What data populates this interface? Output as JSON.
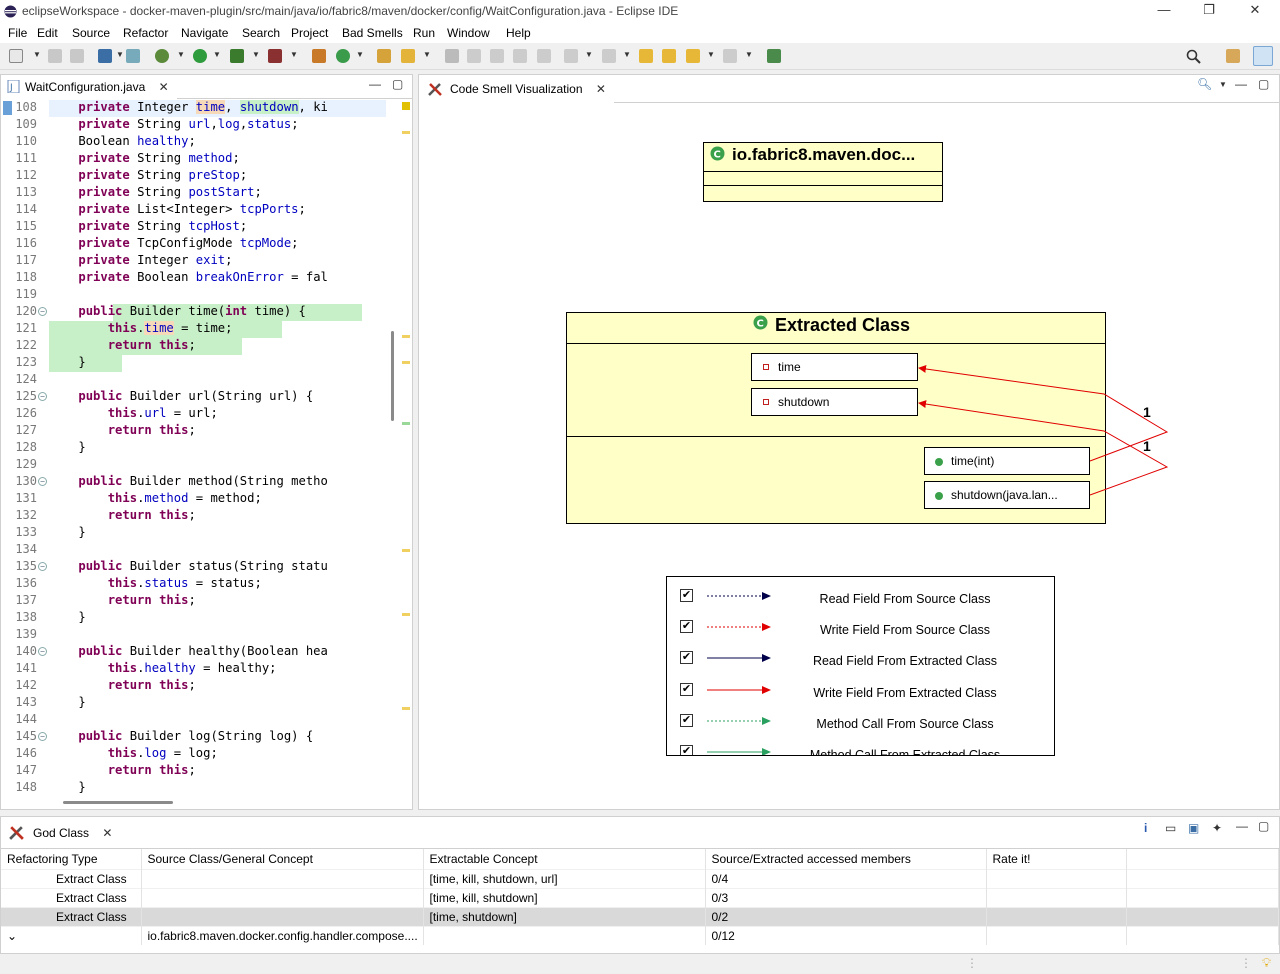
{
  "window": {
    "title": "eclipseWorkspace - docker-maven-plugin/src/main/java/io/fabric8/maven/docker/config/WaitConfiguration.java - Eclipse IDE",
    "minimize": "—",
    "maximize": "❐",
    "close": "✕"
  },
  "menu": [
    "File",
    "Edit",
    "Source",
    "Refactor",
    "Navigate",
    "Search",
    "Project",
    "Bad Smells",
    "Run",
    "Window",
    "Help"
  ],
  "editor": {
    "tab_label": "WaitConfiguration.java",
    "close": "✕",
    "lines": [
      {
        "n": "108",
        "segs": [
          [
            "    ",
            ""
          ],
          [
            "private",
            "kw"
          ],
          [
            " Integer ",
            ""
          ],
          [
            "time",
            "fld"
          ],
          [
            ", ",
            ""
          ],
          [
            "shutdown",
            "fld"
          ],
          [
            ", ki",
            ""
          ]
        ]
      },
      {
        "n": "109",
        "segs": [
          [
            "    ",
            ""
          ],
          [
            "private",
            "kw"
          ],
          [
            " String ",
            ""
          ],
          [
            "url",
            "fld"
          ],
          [
            ",",
            ""
          ],
          [
            "log",
            "fld"
          ],
          [
            ",",
            ""
          ],
          [
            "status",
            "fld"
          ],
          [
            ";",
            ""
          ]
        ]
      },
      {
        "n": "110",
        "segs": [
          [
            "    Boolean ",
            ""
          ],
          [
            "healthy",
            "fld"
          ],
          [
            ";",
            ""
          ]
        ]
      },
      {
        "n": "111",
        "segs": [
          [
            "    ",
            ""
          ],
          [
            "private",
            "kw"
          ],
          [
            " String ",
            ""
          ],
          [
            "method",
            "fld"
          ],
          [
            ";",
            ""
          ]
        ]
      },
      {
        "n": "112",
        "segs": [
          [
            "    ",
            ""
          ],
          [
            "private",
            "kw"
          ],
          [
            " String ",
            ""
          ],
          [
            "preStop",
            "fld"
          ],
          [
            ";",
            ""
          ]
        ]
      },
      {
        "n": "113",
        "segs": [
          [
            "    ",
            ""
          ],
          [
            "private",
            "kw"
          ],
          [
            " String ",
            ""
          ],
          [
            "postStart",
            "fld"
          ],
          [
            ";",
            ""
          ]
        ]
      },
      {
        "n": "114",
        "segs": [
          [
            "    ",
            ""
          ],
          [
            "private",
            "kw"
          ],
          [
            " List<Integer> ",
            ""
          ],
          [
            "tcpPorts",
            "fld"
          ],
          [
            ";",
            ""
          ]
        ]
      },
      {
        "n": "115",
        "segs": [
          [
            "    ",
            ""
          ],
          [
            "private",
            "kw"
          ],
          [
            " String ",
            ""
          ],
          [
            "tcpHost",
            "fld"
          ],
          [
            ";",
            ""
          ]
        ]
      },
      {
        "n": "116",
        "segs": [
          [
            "    ",
            ""
          ],
          [
            "private",
            "kw"
          ],
          [
            " TcpConfigMode ",
            ""
          ],
          [
            "tcpMode",
            "fld"
          ],
          [
            ";",
            ""
          ]
        ]
      },
      {
        "n": "117",
        "segs": [
          [
            "    ",
            ""
          ],
          [
            "private",
            "kw"
          ],
          [
            " Integer ",
            ""
          ],
          [
            "exit",
            "fld"
          ],
          [
            ";",
            ""
          ]
        ]
      },
      {
        "n": "118",
        "segs": [
          [
            "    ",
            ""
          ],
          [
            "private",
            "kw"
          ],
          [
            " Boolean ",
            ""
          ],
          [
            "breakOnError",
            "fld"
          ],
          [
            " = fal",
            ""
          ]
        ]
      },
      {
        "n": "119",
        "segs": [
          [
            "",
            ""
          ]
        ]
      },
      {
        "n": "120",
        "fold": true,
        "segs": [
          [
            "    ",
            ""
          ],
          [
            "public",
            "kw"
          ],
          [
            " Builder time(",
            ""
          ],
          [
            "int",
            "kw"
          ],
          [
            " time) {",
            ""
          ]
        ]
      },
      {
        "n": "121",
        "segs": [
          [
            "        ",
            ""
          ],
          [
            "this",
            "kw"
          ],
          [
            ".",
            ""
          ],
          [
            "time",
            "fld"
          ],
          [
            " = time;",
            ""
          ]
        ]
      },
      {
        "n": "122",
        "segs": [
          [
            "        ",
            ""
          ],
          [
            "return",
            "kw"
          ],
          [
            " ",
            ""
          ],
          [
            "this",
            "kw"
          ],
          [
            ";",
            ""
          ]
        ]
      },
      {
        "n": "123",
        "segs": [
          [
            "    }",
            ""
          ]
        ]
      },
      {
        "n": "124",
        "segs": [
          [
            "",
            ""
          ]
        ]
      },
      {
        "n": "125",
        "fold": true,
        "segs": [
          [
            "    ",
            ""
          ],
          [
            "public",
            "kw"
          ],
          [
            " Builder url(String url) {",
            ""
          ]
        ]
      },
      {
        "n": "126",
        "segs": [
          [
            "        ",
            ""
          ],
          [
            "this",
            "kw"
          ],
          [
            ".",
            ""
          ],
          [
            "url",
            "fld"
          ],
          [
            " = url;",
            ""
          ]
        ]
      },
      {
        "n": "127",
        "segs": [
          [
            "        ",
            ""
          ],
          [
            "return",
            "kw"
          ],
          [
            " ",
            ""
          ],
          [
            "this",
            "kw"
          ],
          [
            ";",
            ""
          ]
        ]
      },
      {
        "n": "128",
        "segs": [
          [
            "    }",
            ""
          ]
        ]
      },
      {
        "n": "129",
        "segs": [
          [
            "",
            ""
          ]
        ]
      },
      {
        "n": "130",
        "fold": true,
        "segs": [
          [
            "    ",
            ""
          ],
          [
            "public",
            "kw"
          ],
          [
            " Builder method(String metho",
            ""
          ]
        ]
      },
      {
        "n": "131",
        "segs": [
          [
            "        ",
            ""
          ],
          [
            "this",
            "kw"
          ],
          [
            ".",
            ""
          ],
          [
            "method",
            "fld"
          ],
          [
            " = method;",
            ""
          ]
        ]
      },
      {
        "n": "132",
        "segs": [
          [
            "        ",
            ""
          ],
          [
            "return",
            "kw"
          ],
          [
            " ",
            ""
          ],
          [
            "this",
            "kw"
          ],
          [
            ";",
            ""
          ]
        ]
      },
      {
        "n": "133",
        "segs": [
          [
            "    }",
            ""
          ]
        ]
      },
      {
        "n": "134",
        "segs": [
          [
            "",
            ""
          ]
        ]
      },
      {
        "n": "135",
        "fold": true,
        "segs": [
          [
            "    ",
            ""
          ],
          [
            "public",
            "kw"
          ],
          [
            " Builder status(String statu",
            ""
          ]
        ]
      },
      {
        "n": "136",
        "segs": [
          [
            "        ",
            ""
          ],
          [
            "this",
            "kw"
          ],
          [
            ".",
            ""
          ],
          [
            "status",
            "fld"
          ],
          [
            " = status;",
            ""
          ]
        ]
      },
      {
        "n": "137",
        "segs": [
          [
            "        ",
            ""
          ],
          [
            "return",
            "kw"
          ],
          [
            " ",
            ""
          ],
          [
            "this",
            "kw"
          ],
          [
            ";",
            ""
          ]
        ]
      },
      {
        "n": "138",
        "segs": [
          [
            "    }",
            ""
          ]
        ]
      },
      {
        "n": "139",
        "segs": [
          [
            "",
            ""
          ]
        ]
      },
      {
        "n": "140",
        "fold": true,
        "segs": [
          [
            "    ",
            ""
          ],
          [
            "public",
            "kw"
          ],
          [
            " Builder healthy(Boolean hea",
            ""
          ]
        ]
      },
      {
        "n": "141",
        "segs": [
          [
            "        ",
            ""
          ],
          [
            "this",
            "kw"
          ],
          [
            ".",
            ""
          ],
          [
            "healthy",
            "fld"
          ],
          [
            " = healthy;",
            ""
          ]
        ]
      },
      {
        "n": "142",
        "segs": [
          [
            "        ",
            ""
          ],
          [
            "return",
            "kw"
          ],
          [
            " ",
            ""
          ],
          [
            "this",
            "kw"
          ],
          [
            ";",
            ""
          ]
        ]
      },
      {
        "n": "143",
        "segs": [
          [
            "    }",
            ""
          ]
        ]
      },
      {
        "n": "144",
        "segs": [
          [
            "",
            ""
          ]
        ]
      },
      {
        "n": "145",
        "fold": true,
        "segs": [
          [
            "    ",
            ""
          ],
          [
            "public",
            "kw"
          ],
          [
            " Builder log(String log) {",
            ""
          ]
        ]
      },
      {
        "n": "146",
        "segs": [
          [
            "        ",
            ""
          ],
          [
            "this",
            "kw"
          ],
          [
            ".",
            ""
          ],
          [
            "log",
            "fld"
          ],
          [
            " = log;",
            ""
          ]
        ]
      },
      {
        "n": "147",
        "segs": [
          [
            "        ",
            ""
          ],
          [
            "return",
            "kw"
          ],
          [
            " ",
            ""
          ],
          [
            "this",
            "kw"
          ],
          [
            ";",
            ""
          ]
        ]
      },
      {
        "n": "148",
        "segs": [
          [
            "    }",
            ""
          ]
        ]
      }
    ]
  },
  "viz": {
    "tab_label": "Code Smell Visualization",
    "close": "✕",
    "source_class": "io.fabric8.maven.doc...",
    "extracted_class": "Extracted Class",
    "fields": [
      "time",
      "shutdown"
    ],
    "methods": [
      "time(int)",
      "shutdown(java.lan..."
    ],
    "edge_labels": [
      "1",
      "1"
    ],
    "colors": {
      "read_source": "#00004a",
      "write_source": "#e00000",
      "read_extracted": "#00004a",
      "write_extracted": "#e00000",
      "call_source": "#2aa060",
      "call_extracted": "#2aa060",
      "box": "#ffffc8"
    },
    "legend": [
      {
        "label": "Read Field From Source Class",
        "checked": "✔"
      },
      {
        "label": "Write Field From Source Class",
        "checked": "✔"
      },
      {
        "label": "Read Field From Extracted Class",
        "checked": "✔"
      },
      {
        "label": "Write Field From Extracted Class",
        "checked": "✔"
      },
      {
        "label": "Method Call From Source Class",
        "checked": "✔"
      },
      {
        "label": "Method Call From Extracted Class",
        "checked": "✔"
      }
    ]
  },
  "godclass": {
    "tab_label": "God Class",
    "close": "✕",
    "columns": [
      "Refactoring Type",
      "Source Class/General Concept",
      "Extractable Concept",
      "Source/Extracted accessed members",
      "Rate it!"
    ],
    "rows": [
      [
        "Extract Class",
        "",
        "[time, kill, shutdown, url]",
        "0/4",
        ""
      ],
      [
        "Extract Class",
        "",
        "[time, kill, shutdown]",
        "0/3",
        ""
      ],
      [
        "Extract Class",
        "",
        "[time, shutdown]",
        "0/2",
        ""
      ],
      [
        "⌄",
        "io.fabric8.maven.docker.config.handler.compose....",
        "",
        "0/12",
        ""
      ]
    ]
  }
}
